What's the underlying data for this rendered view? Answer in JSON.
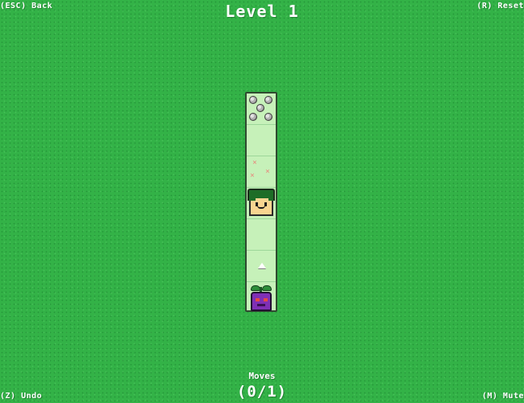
{
  "hud": {
    "back": "(ESC) Back",
    "reset": "(R) Reset",
    "undo": "(Z) Undo",
    "mute": "(M) Mute"
  },
  "title": "Level 1",
  "moves": {
    "label": "Moves",
    "count": "(0/1)"
  },
  "board": {
    "columns": 1,
    "rows": 7,
    "tiles": [
      {
        "content": "rocks",
        "icon": "rock-cluster-icon"
      },
      {
        "content": "empty"
      },
      {
        "content": "flowers",
        "icon": "flower-icon"
      },
      {
        "content": "player",
        "icon": "player-face-icon"
      },
      {
        "content": "empty"
      },
      {
        "content": "seed",
        "icon": "seed-icon"
      },
      {
        "content": "plant-monster",
        "icon": "plant-monster-icon"
      }
    ]
  },
  "colors": {
    "grass": "#33b247",
    "tile": "#c6f1b9",
    "border": "#2f4a30",
    "monster": "#7f2fb5",
    "hair": "#1d6d27",
    "skin": "#f9d590"
  }
}
